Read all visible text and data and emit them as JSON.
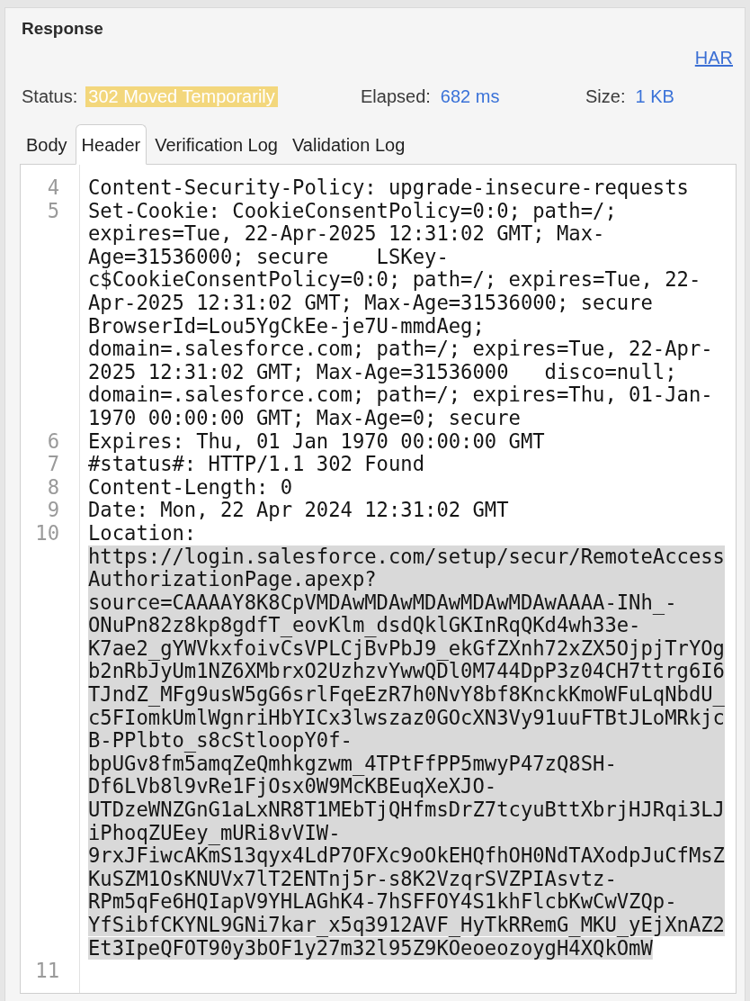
{
  "panel": {
    "title": "Response",
    "har_link": "HAR"
  },
  "summary": [
    {
      "label": "Status:",
      "value": "302 Moved Temporarily",
      "kind": "badge"
    },
    {
      "label": "Elapsed:",
      "value": "682 ms",
      "kind": "value"
    },
    {
      "label": "Size:",
      "value": "1 KB",
      "kind": "value"
    }
  ],
  "tabs": [
    {
      "label": "Body",
      "selected": false
    },
    {
      "label": "Header",
      "selected": true
    },
    {
      "label": "Verification Log",
      "selected": false
    },
    {
      "label": "Validation Log",
      "selected": false
    }
  ],
  "header_lines": [
    {
      "number": "4",
      "segments": [
        {
          "rows": [
            "Content-Security-Policy: upgrade-insecure-requests"
          ],
          "selected": false
        }
      ]
    },
    {
      "number": "5",
      "segments": [
        {
          "rows": [
            "Set-Cookie: CookieConsentPolicy=0:0; path=/;",
            "expires=Tue, 22-Apr-2025 12:31:02 GMT; Max-",
            "Age=31536000; secure    LSKey-",
            "c$CookieConsentPolicy=0:0; path=/; expires=Tue, 22-",
            "Apr-2025 12:31:02 GMT; Max-Age=31536000; secure",
            "BrowserId=Lou5YgCkEe-je7U-mmdAeg;",
            "domain=.salesforce.com; path=/; expires=Tue, 22-Apr-",
            "2025 12:31:02 GMT; Max-Age=31536000   disco=null;",
            "domain=.salesforce.com; path=/; expires=Thu, 01-Jan-",
            "1970 00:00:00 GMT; Max-Age=0; secure"
          ],
          "selected": false
        }
      ]
    },
    {
      "number": "6",
      "segments": [
        {
          "rows": [
            "Expires: Thu, 01 Jan 1970 00:00:00 GMT"
          ],
          "selected": false
        }
      ]
    },
    {
      "number": "7",
      "segments": [
        {
          "rows": [
            "#status#: HTTP/1.1 302 Found"
          ],
          "selected": false
        }
      ]
    },
    {
      "number": "8",
      "segments": [
        {
          "rows": [
            "Content-Length: 0"
          ],
          "selected": false
        }
      ]
    },
    {
      "number": "9",
      "segments": [
        {
          "rows": [
            "Date: Mon, 22 Apr 2024 12:31:02 GMT"
          ],
          "selected": false
        }
      ]
    },
    {
      "number": "10",
      "segments": [
        {
          "rows": [
            "Location:"
          ],
          "selected": false
        },
        {
          "rows": [
            "https://login.salesforce.com/setup/secur/RemoteAccess",
            "AuthorizationPage.apexp?",
            "source=CAAAAY8K8CpVMDAwMDAwMDAwMDAwMDAwAAAA-INh_-",
            "ONuPn82z8kp8gdfT_eovKlm_dsdQklGKInRqQKd4wh33e-",
            "K7ae2_gYWVkxfoivCsVPLCjBvPbJ9_ekGfZXnh72xZX5OjpjTrYOg",
            "b2nRbJyUm1NZ6XMbrxO2UzhzvYwwQDl0M744DpP3z04CH7ttrg6I6",
            "TJndZ_MFg9usW5gG6srlFqeEzR7h0NvY8bf8KnckKmoWFuLqNbdU_",
            "c5FIomkUmlWgnriHbYICx3lwszaz0GOcXN3Vy91uuFTBtJLoMRkjc",
            "B-PPlbto_s8cStloopY0f-",
            "bpUGv8fm5amqZeQmhkgzwm_4TPtFfPP5mwyP47zQ8SH-",
            "Df6LVb8l9vRe1FjOsx0W9McKBEuqXeXJO-",
            "UTDzeWNZGnG1aLxNR8T1MEbTjQHfmsDrZ7tcyuBttXbrjHJRqi3LJ",
            "iPhoqZUEey_mURi8vVIW-",
            "9rxJFiwcAKmS13qyx4LdP7OFXc9oOkEHQfhOH0NdTAXodpJuCfMsZ",
            "KuSZM1OsKNUVx7lT2ENTnj5r-s8K2VzqrSVZPIAsvtz-",
            "RPm5qFe6HQIapV9YHLAGhK4-7hSFFOY4S1khFlcbKwCwVZQp-",
            "YfSibfCKYNL9GNi7kar_x5q3912AVF_HyTkRRemG_MKU_yEjXnAZ2",
            "Et3IpeQFOT90y3bOF1y27m32l95Z9KOeoeozoygH4XQkOmW"
          ],
          "selected": true
        }
      ]
    },
    {
      "number": "11"
    }
  ]
}
